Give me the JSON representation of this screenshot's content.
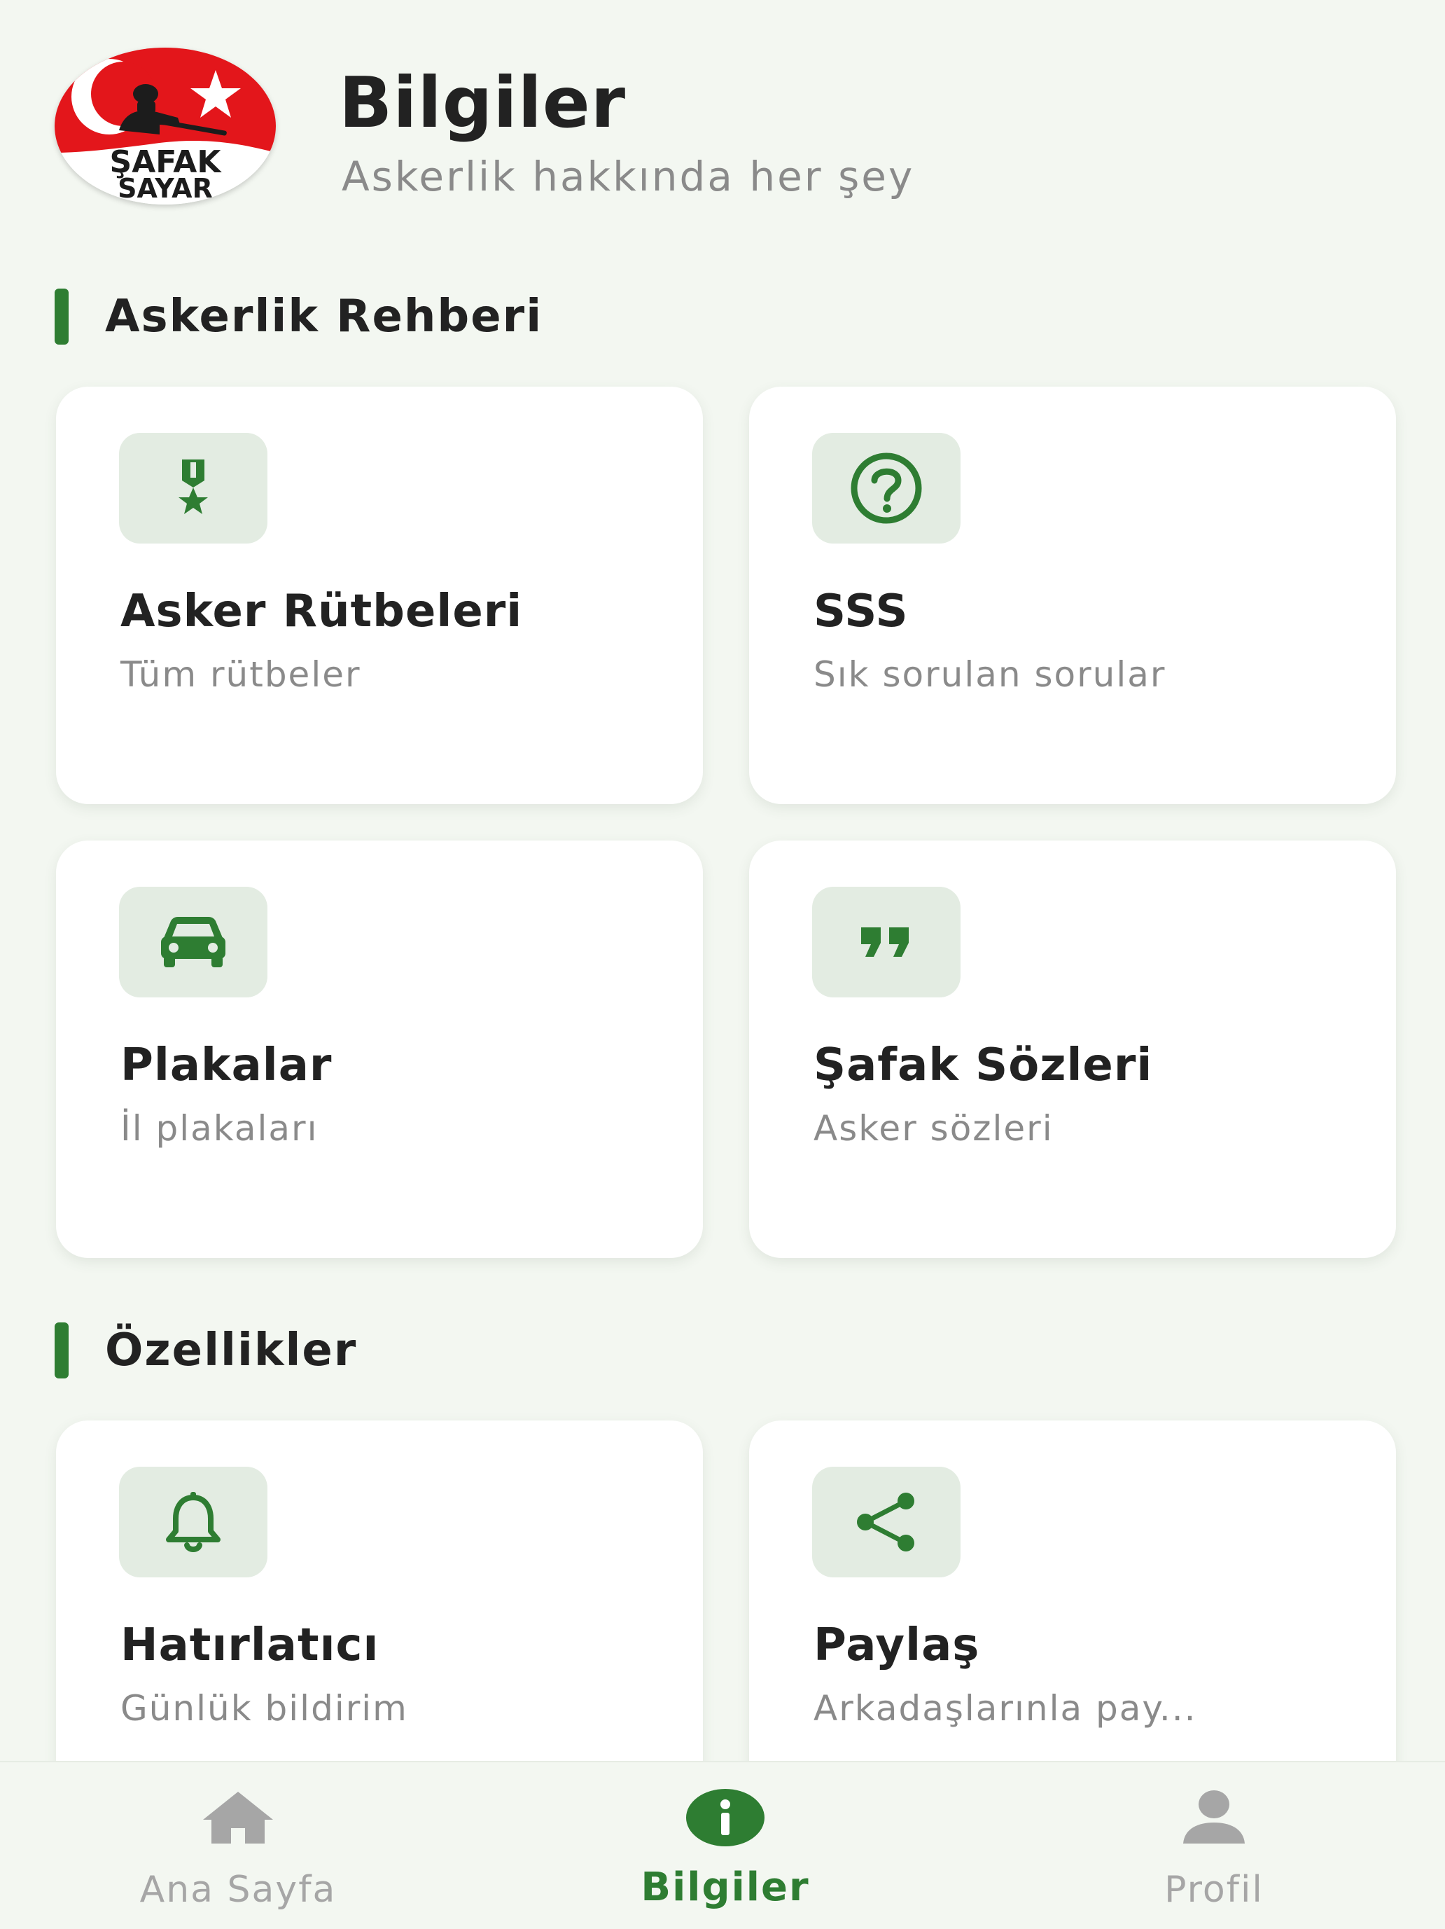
{
  "header": {
    "title": "Bilgiler",
    "subtitle": "Askerlik hakkında her şey",
    "logo_text_line1": "ŞAFAK",
    "logo_text_line2": "SAYAR"
  },
  "sections": [
    {
      "label": "Askerlik Rehberi",
      "cards": [
        {
          "title": "Asker Rütbeleri",
          "subtitle": "Tüm rütbeler",
          "icon": "medal-icon"
        },
        {
          "title": "SSS",
          "subtitle": "Sık sorulan sorular",
          "icon": "help-circle-icon"
        },
        {
          "title": "Plakalar",
          "subtitle": "İl plakaları",
          "icon": "car-icon"
        },
        {
          "title": "Şafak Sözleri",
          "subtitle": "Asker sözleri",
          "icon": "quote-icon"
        }
      ]
    },
    {
      "label": "Özellikler",
      "cards": [
        {
          "title": "Hatırlatıcı",
          "subtitle": "Günlük bildirim",
          "icon": "bell-icon"
        },
        {
          "title": "Paylaş",
          "subtitle": "Arkadaşlarınla pay...",
          "icon": "share-icon"
        }
      ]
    }
  ],
  "bottom_nav": {
    "items": [
      {
        "label": "Ana Sayfa",
        "icon": "home-icon",
        "active": false
      },
      {
        "label": "Bilgiler",
        "icon": "info-icon",
        "active": true
      },
      {
        "label": "Profil",
        "icon": "person-icon",
        "active": false
      }
    ]
  },
  "colors": {
    "accent": "#2e7d32",
    "background": "#f3f7f1",
    "card": "#ffffff",
    "icon_tile": "#e3ece2",
    "logo_red": "#e3161b"
  }
}
